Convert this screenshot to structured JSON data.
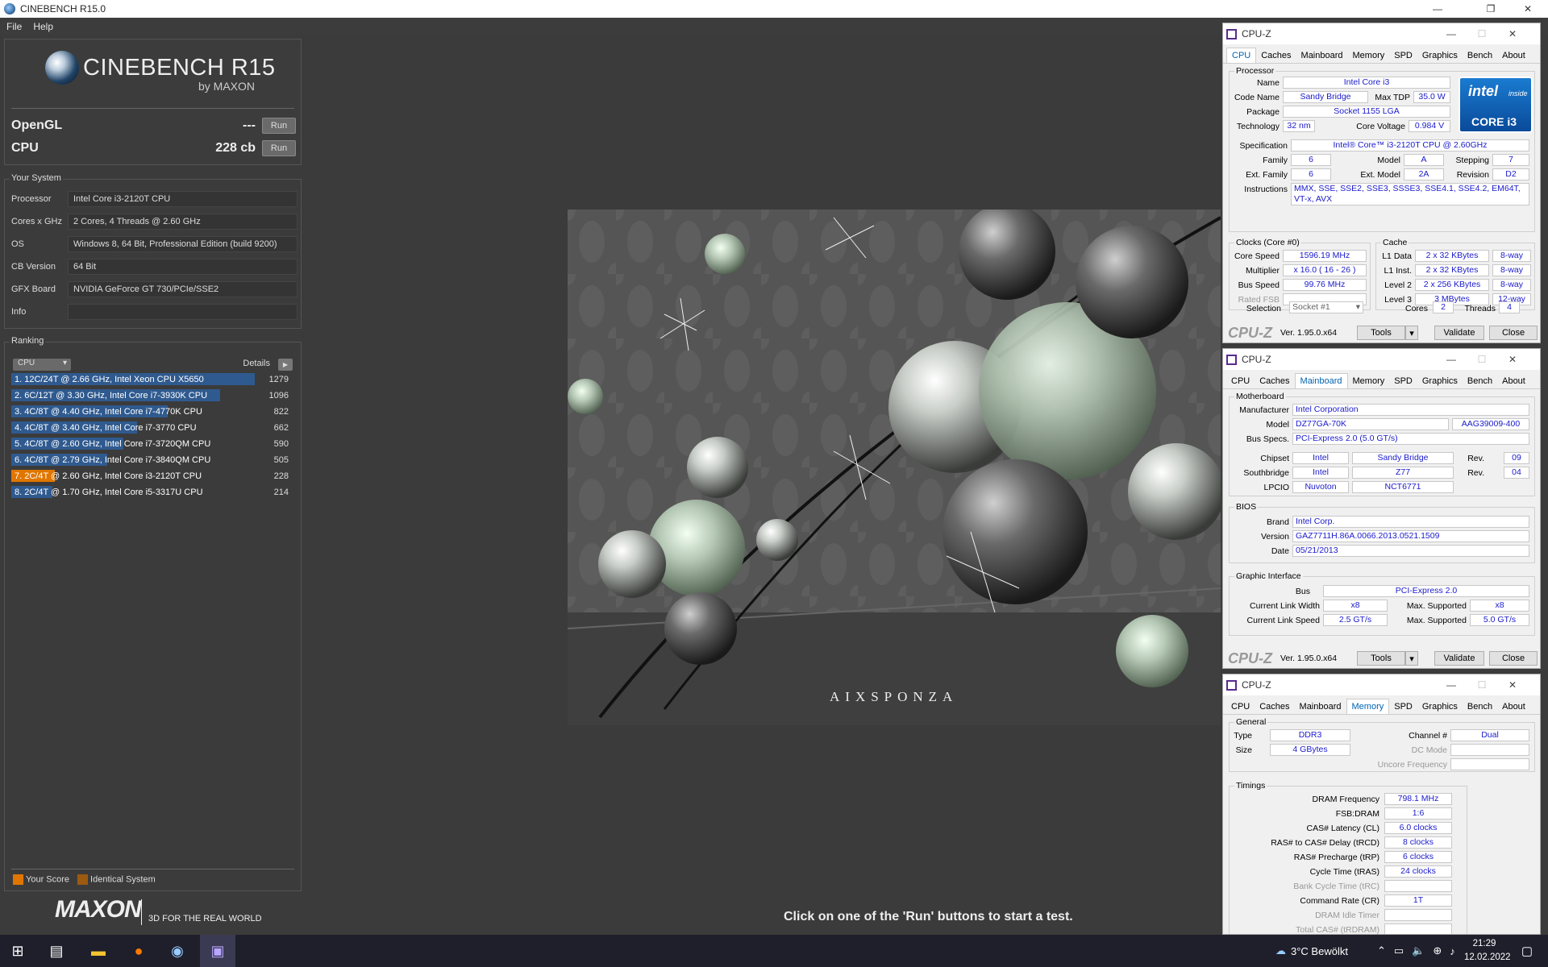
{
  "window": {
    "title": "CINEBENCH R15.0"
  },
  "menu": [
    "File",
    "Help"
  ],
  "logo": {
    "name": "CINEBENCH R15",
    "sub": "by MAXON"
  },
  "scores": {
    "opengl_label": "OpenGL",
    "opengl_value": "---",
    "cpu_label": "CPU",
    "cpu_value": "228 cb",
    "run_label": "Run"
  },
  "system": {
    "title": "Your System",
    "rows": [
      {
        "k": "Processor",
        "v": "Intel Core i3-2120T CPU"
      },
      {
        "k": "Cores x GHz",
        "v": "2 Cores, 4 Threads @ 2.60 GHz"
      },
      {
        "k": "OS",
        "v": "Windows 8, 64 Bit, Professional Edition (build 9200)"
      },
      {
        "k": "CB Version",
        "v": "64 Bit"
      },
      {
        "k": "GFX Board",
        "v": "NVIDIA GeForce GT 730/PCIe/SSE2"
      },
      {
        "k": "Info",
        "v": ""
      }
    ]
  },
  "ranking": {
    "title": "Ranking",
    "dropdown": "CPU",
    "details": "Details",
    "max": 1279,
    "items": [
      {
        "text": "1. 12C/24T @ 2.66 GHz, Intel Xeon CPU X5650",
        "score": 1279,
        "mine": false
      },
      {
        "text": "2. 6C/12T @ 3.30 GHz,  Intel Core i7-3930K CPU",
        "score": 1096,
        "mine": false
      },
      {
        "text": "3. 4C/8T @ 4.40 GHz, Intel Core i7-4770K CPU",
        "score": 822,
        "mine": false
      },
      {
        "text": "4. 4C/8T @ 3.40 GHz,  Intel Core i7-3770 CPU",
        "score": 662,
        "mine": false
      },
      {
        "text": "5. 4C/8T @ 2.60 GHz, Intel Core i7-3720QM CPU",
        "score": 590,
        "mine": false
      },
      {
        "text": "6. 4C/8T @ 2.79 GHz,  Intel Core i7-3840QM CPU",
        "score": 505,
        "mine": false
      },
      {
        "text": "7. 2C/4T @ 2.60 GHz,  Intel Core i3-2120T CPU",
        "score": 228,
        "mine": true
      },
      {
        "text": "8. 2C/4T @ 1.70 GHz,  Intel Core i5-3317U CPU",
        "score": 214,
        "mine": false
      }
    ],
    "legend_yours": "Your Score",
    "legend_identical": "Identical System"
  },
  "footer": {
    "brand": "MAXON",
    "tagline": "3D FOR THE REAL WORLD",
    "message": "Click on one of the 'Run' buttons to start a test."
  },
  "render": {
    "watermark": "AIXSPONZA"
  },
  "cpuz_common": {
    "title": "CPU-Z",
    "tabs": [
      "CPU",
      "Caches",
      "Mainboard",
      "Memory",
      "SPD",
      "Graphics",
      "Bench",
      "About"
    ],
    "brand": "CPU-Z",
    "version": "Ver. 1.95.0.x64",
    "tools": "Tools",
    "validate": "Validate",
    "close": "Close"
  },
  "cpuz_cpu": {
    "processor_group": "Processor",
    "name_label": "Name",
    "name": "Intel Core i3",
    "codename_label": "Code Name",
    "codename": "Sandy Bridge",
    "maxtdp_label": "Max TDP",
    "maxtdp": "35.0 W",
    "package_label": "Package",
    "package": "Socket 1155 LGA",
    "tech_label": "Technology",
    "tech": "32 nm",
    "corevolt_label": "Core Voltage",
    "corevolt": "0.984 V",
    "spec_label": "Specification",
    "spec": "Intel® Core™ i3-2120T CPU @ 2.60GHz",
    "family_label": "Family",
    "family": "6",
    "model_label": "Model",
    "model": "A",
    "stepping_label": "Stepping",
    "stepping": "7",
    "extfamily_label": "Ext. Family",
    "extfamily": "6",
    "extmodel_label": "Ext. Model",
    "extmodel": "2A",
    "revision_label": "Revision",
    "revision": "D2",
    "instr_label": "Instructions",
    "instr": "MMX, SSE, SSE2, SSE3, SSSE3, SSE4.1, SSE4.2, EM64T, VT-x, AVX",
    "badge_top": "intel",
    "badge_inside": "inside",
    "badge_bottom": "CORE i3",
    "clocks_group": "Clocks (Core #0)",
    "corespeed_label": "Core Speed",
    "corespeed": "1596.19 MHz",
    "multiplier_label": "Multiplier",
    "multiplier": "x 16.0 ( 16 - 26 )",
    "busspeed_label": "Bus Speed",
    "busspeed": "99.76 MHz",
    "ratedfsb_label": "Rated FSB",
    "ratedfsb": "",
    "cache_group": "Cache",
    "l1d_label": "L1 Data",
    "l1d": "2 x 32 KBytes",
    "l1d_way": "8-way",
    "l1i_label": "L1 Inst.",
    "l1i": "2 x 32 KBytes",
    "l1i_way": "8-way",
    "l2_label": "Level 2",
    "l2": "2 x 256 KBytes",
    "l2_way": "8-way",
    "l3_label": "Level 3",
    "l3": "3 MBytes",
    "l3_way": "12-way",
    "selection_label": "Selection",
    "selection": "Socket #1",
    "cores_label": "Cores",
    "cores": "2",
    "threads_label": "Threads",
    "threads": "4"
  },
  "cpuz_mb": {
    "mb_group": "Motherboard",
    "manufacturer_label": "Manufacturer",
    "manufacturer": "Intel Corporation",
    "model_label": "Model",
    "model": "DZ77GA-70K",
    "model_rev": "AAG39009-400",
    "busspecs_label": "Bus Specs.",
    "busspecs": "PCI-Express 2.0 (5.0 GT/s)",
    "chipset_label": "Chipset",
    "chipset_vendor": "Intel",
    "chipset": "Sandy Bridge",
    "chipset_rev_label": "Rev.",
    "chipset_rev": "09",
    "south_label": "Southbridge",
    "south_vendor": "Intel",
    "south": "Z77",
    "south_rev_label": "Rev.",
    "south_rev": "04",
    "lpcio_label": "LPCIO",
    "lpcio_vendor": "Nuvoton",
    "lpcio": "NCT6771",
    "bios_group": "BIOS",
    "brand_label": "Brand",
    "brand": "Intel Corp.",
    "version_label": "Version",
    "version": "GAZ7711H.86A.0066.2013.0521.1509",
    "date_label": "Date",
    "date": "05/21/2013",
    "gi_group": "Graphic Interface",
    "bus_label": "Bus",
    "bus": "PCI-Express 2.0",
    "clw_label": "Current Link Width",
    "clw": "x8",
    "msw_label": "Max. Supported",
    "msw": "x8",
    "cls_label": "Current Link Speed",
    "cls": "2.5 GT/s",
    "mss_label": "Max. Supported",
    "mss": "5.0 GT/s"
  },
  "cpuz_mem": {
    "general_group": "General",
    "type_label": "Type",
    "type": "DDR3",
    "size_label": "Size",
    "size": "4 GBytes",
    "channel_label": "Channel #",
    "channel": "Dual",
    "dcmode_label": "DC Mode",
    "dcmode": "",
    "uncore_label": "Uncore Frequency",
    "uncore": "",
    "timings_group": "Timings",
    "rows": [
      {
        "k": "DRAM Frequency",
        "v": "798.1 MHz",
        "dim": false
      },
      {
        "k": "FSB:DRAM",
        "v": "1:6",
        "dim": false
      },
      {
        "k": "CAS# Latency (CL)",
        "v": "6.0 clocks",
        "dim": false
      },
      {
        "k": "RAS# to CAS# Delay (tRCD)",
        "v": "8 clocks",
        "dim": false
      },
      {
        "k": "RAS# Precharge (tRP)",
        "v": "6 clocks",
        "dim": false
      },
      {
        "k": "Cycle Time (tRAS)",
        "v": "24 clocks",
        "dim": false
      },
      {
        "k": "Bank Cycle Time (tRC)",
        "v": "",
        "dim": true
      },
      {
        "k": "Command Rate (CR)",
        "v": "1T",
        "dim": false
      },
      {
        "k": "DRAM Idle Timer",
        "v": "",
        "dim": true
      },
      {
        "k": "Total CAS# (tRDRAM)",
        "v": "",
        "dim": true
      }
    ]
  },
  "taskbar": {
    "weather": "3°C  Bewölkt",
    "time": "21:29",
    "date": "12.02.2022"
  }
}
